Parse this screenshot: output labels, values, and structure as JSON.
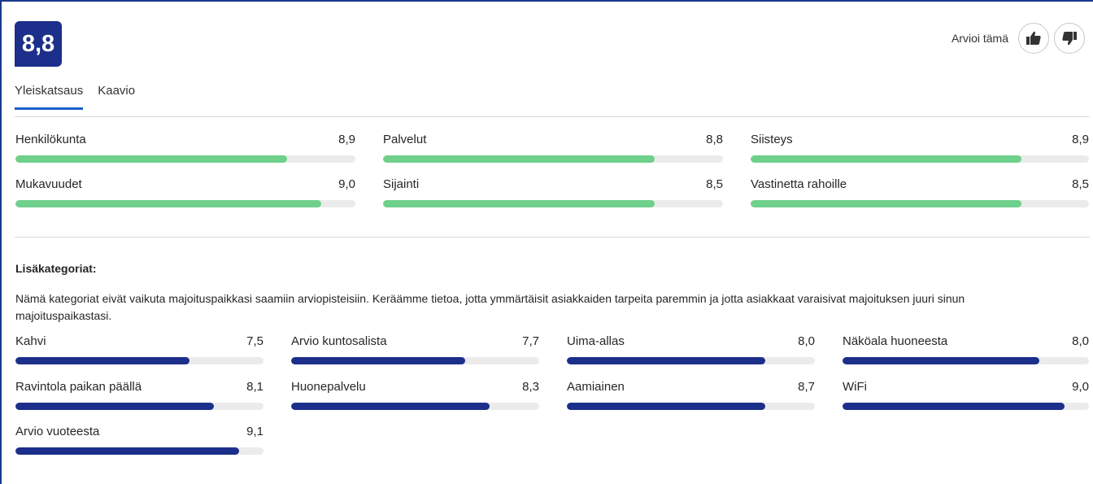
{
  "score": "8,8",
  "rate": {
    "label": "Arvioi tämä",
    "like_icon": "thumbs-up-icon",
    "dislike_icon": "thumbs-down-icon"
  },
  "tabs": [
    {
      "label": "Yleiskatsaus"
    },
    {
      "label": "Kaavio"
    }
  ],
  "main_categories": [
    {
      "label": "Henkilökunta",
      "score": "8,9",
      "fill": 0.8
    },
    {
      "label": "Palvelut",
      "score": "8,8",
      "fill": 0.8
    },
    {
      "label": "Siisteys",
      "score": "8,9",
      "fill": 0.8
    },
    {
      "label": "Mukavuudet",
      "score": "9,0",
      "fill": 0.9
    },
    {
      "label": "Sijainti",
      "score": "8,5",
      "fill": 0.8
    },
    {
      "label": "Vastinetta rahoille",
      "score": "8,5",
      "fill": 0.8
    }
  ],
  "extra": {
    "title": "Lisäkategoriat:",
    "description": "Nämä kategoriat eivät vaikuta majoituspaikkasi saamiin arviopisteisiin. Keräämme tietoa, jotta ymmärtäisit asiakkaiden tarpeita paremmin ja jotta asiakkaat varaisivat majoituksen juuri sinun majoituspaikastasi.",
    "categories": [
      {
        "label": "Kahvi",
        "score": "7,5",
        "fill": 0.7
      },
      {
        "label": "Arvio kuntosalista",
        "score": "7,7",
        "fill": 0.7
      },
      {
        "label": "Uima-allas",
        "score": "8,0",
        "fill": 0.8
      },
      {
        "label": "Näköala huoneesta",
        "score": "8,0",
        "fill": 0.8
      },
      {
        "label": "Ravintola paikan päällä",
        "score": "8,1",
        "fill": 0.8
      },
      {
        "label": "Huonepalvelu",
        "score": "8,3",
        "fill": 0.8
      },
      {
        "label": "Aamiainen",
        "score": "8,7",
        "fill": 0.8
      },
      {
        "label": "WiFi",
        "score": "9,0",
        "fill": 0.9
      },
      {
        "label": "Arvio vuoteesta",
        "score": "9,1",
        "fill": 0.9
      }
    ]
  }
}
